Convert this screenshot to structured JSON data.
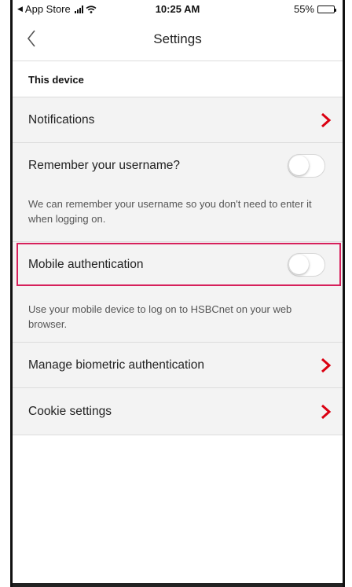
{
  "status_bar": {
    "back_app": "App Store",
    "time": "10:25 AM",
    "battery_percent": "55%",
    "battery_level": 0.55
  },
  "nav": {
    "title": "Settings",
    "back_icon": "chevron-left-icon"
  },
  "section": {
    "title": "This device"
  },
  "items": {
    "notifications": {
      "label": "Notifications"
    },
    "remember_username": {
      "label": "Remember your username?",
      "enabled": false,
      "description": "We can remember your username so you don't need to enter it when logging on."
    },
    "mobile_auth": {
      "label": "Mobile authentication",
      "enabled": false,
      "description": "Use your mobile device to log on to HSBCnet on your web browser."
    },
    "biometric": {
      "label": "Manage biometric authentication"
    },
    "cookies": {
      "label": "Cookie settings"
    }
  },
  "colors": {
    "accent": "#db0011",
    "highlight": "#d6205b",
    "divider": "#dcdcdc",
    "background": "#f3f3f3"
  }
}
